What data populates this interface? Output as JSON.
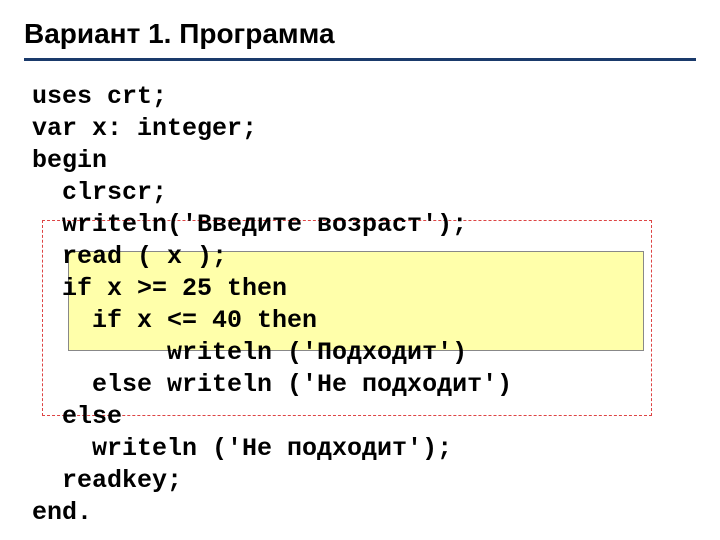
{
  "title": "Вариант 1. Программа",
  "code": {
    "l1": "uses crt;",
    "l2": "var x: integer;",
    "l3": "begin",
    "l4": "  clrscr;",
    "l5": "  writeln('Введите возраст');",
    "l6": "  read ( x );",
    "l7": "  if x >= 25 then",
    "l8": "    if x <= 40 then",
    "l9": "         writeln ('Подходит')",
    "l10": "    else writeln ('Не подходит')",
    "l11": "  else",
    "l12": "    writeln ('Не подходит');",
    "l13": "  readkey;",
    "l14": "end."
  }
}
